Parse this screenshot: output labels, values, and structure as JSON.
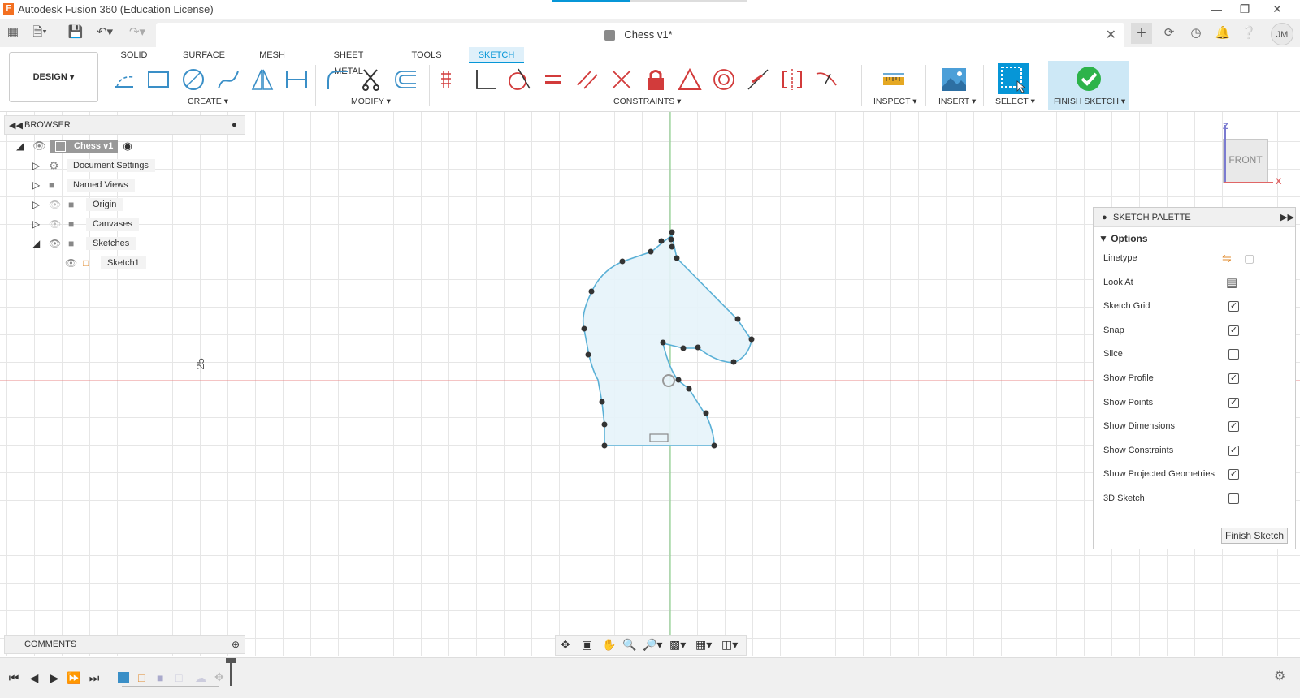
{
  "window": {
    "title": "Autodesk Fusion 360 (Education License)",
    "app_icon_letter": "F",
    "progress_fraction": 0.4
  },
  "appbar": {
    "document_title": "Chess v1*",
    "avatar_initials": "JM"
  },
  "toolbar": {
    "workspace": "DESIGN",
    "tabs": [
      "SOLID",
      "SURFACE",
      "MESH",
      "SHEET METAL",
      "TOOLS",
      "SKETCH"
    ],
    "active_tab": "SKETCH",
    "groups": {
      "create": "CREATE",
      "modify": "MODIFY",
      "constraints": "CONSTRAINTS",
      "inspect": "INSPECT",
      "insert": "INSERT",
      "select": "SELECT",
      "finish": "FINISH SKETCH"
    }
  },
  "browser": {
    "title": "BROWSER",
    "root": "Chess v1",
    "items": [
      "Document Settings",
      "Named Views",
      "Origin",
      "Canvases",
      "Sketches"
    ],
    "sketch_item": "Sketch1"
  },
  "canvas": {
    "dimension_label": "-25",
    "view_cube_face": "FRONT",
    "axis_z": "Z",
    "axis_x": "X"
  },
  "sketch_palette": {
    "title": "SKETCH PALETTE",
    "section": "Options",
    "rows": [
      {
        "label": "Linetype",
        "kind": "icons"
      },
      {
        "label": "Look At",
        "kind": "icon"
      },
      {
        "label": "Sketch Grid",
        "kind": "check",
        "checked": true
      },
      {
        "label": "Snap",
        "kind": "check",
        "checked": true
      },
      {
        "label": "Slice",
        "kind": "check",
        "checked": false
      },
      {
        "label": "Show Profile",
        "kind": "check",
        "checked": true
      },
      {
        "label": "Show Points",
        "kind": "check",
        "checked": true
      },
      {
        "label": "Show Dimensions",
        "kind": "check",
        "checked": true
      },
      {
        "label": "Show Constraints",
        "kind": "check",
        "checked": true
      },
      {
        "label": "Show Projected Geometries",
        "kind": "check",
        "checked": true
      },
      {
        "label": "3D Sketch",
        "kind": "check",
        "checked": false
      }
    ],
    "finish_button": "Finish Sketch"
  },
  "comments": {
    "title": "COMMENTS"
  },
  "colors": {
    "accent": "#0696d7",
    "sketch_line": "#5ab0d6",
    "profile_fill": "#e8f4fb",
    "x_axis": "#e06666",
    "z_axis": "#6cc46c",
    "constraint_red": "#d23b3b",
    "finish_green": "#2db34a"
  }
}
